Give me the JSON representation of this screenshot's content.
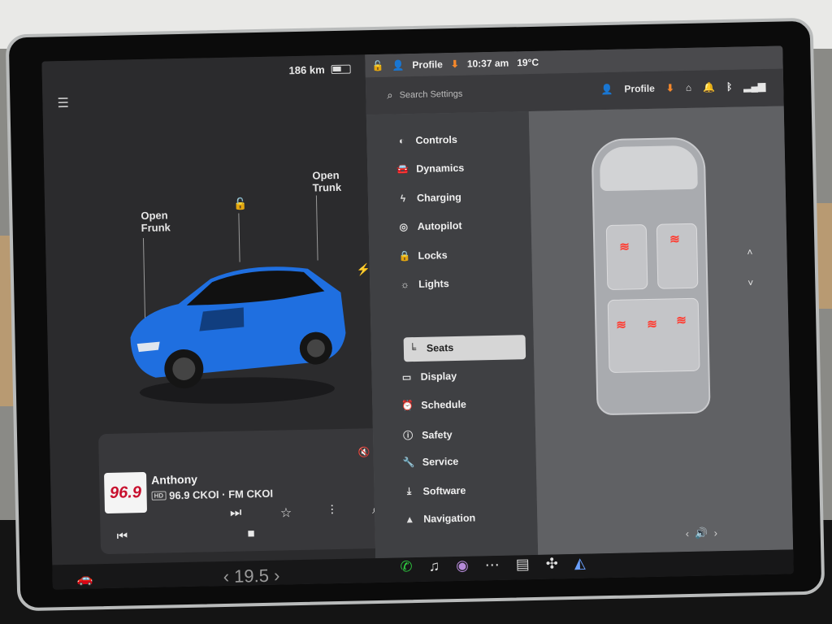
{
  "status": {
    "range": "186 km"
  },
  "top": {
    "profile": "Profile",
    "time": "10:37 am",
    "temp": "19°C"
  },
  "car_view": {
    "frunk_label_line1": "Open",
    "frunk_label_line2": "Frunk",
    "trunk_label_line1": "Open",
    "trunk_label_line2": "Trunk"
  },
  "media": {
    "station_logo": "96.9",
    "title": "Anthony",
    "subtitle": "96.9 CKOI · FM CKOI",
    "hd_tag": "HD"
  },
  "settings": {
    "search_placeholder": "Search Settings",
    "profile": "Profile",
    "menu": [
      {
        "label": "Controls",
        "icon": "toggle-icon"
      },
      {
        "label": "Dynamics",
        "icon": "car-icon"
      },
      {
        "label": "Charging",
        "icon": "bolt-icon"
      },
      {
        "label": "Autopilot",
        "icon": "steering-wheel-icon"
      },
      {
        "label": "Locks",
        "icon": "lock-icon"
      },
      {
        "label": "Lights",
        "icon": "sun-icon"
      },
      {
        "label": "Seats",
        "icon": "seat-icon"
      },
      {
        "label": "Display",
        "icon": "display-icon"
      },
      {
        "label": "Schedule",
        "icon": "clock-icon"
      },
      {
        "label": "Safety",
        "icon": "info-icon"
      },
      {
        "label": "Service",
        "icon": "wrench-icon"
      },
      {
        "label": "Software",
        "icon": "download-icon"
      },
      {
        "label": "Navigation",
        "icon": "nav-arrow-icon"
      }
    ],
    "active": "Seats"
  },
  "climate": {
    "temp": "19.5"
  },
  "colors": {
    "accent_orange": "#f5882b",
    "heat_red": "#ff3b30",
    "car_blue": "#1f6fe0"
  }
}
